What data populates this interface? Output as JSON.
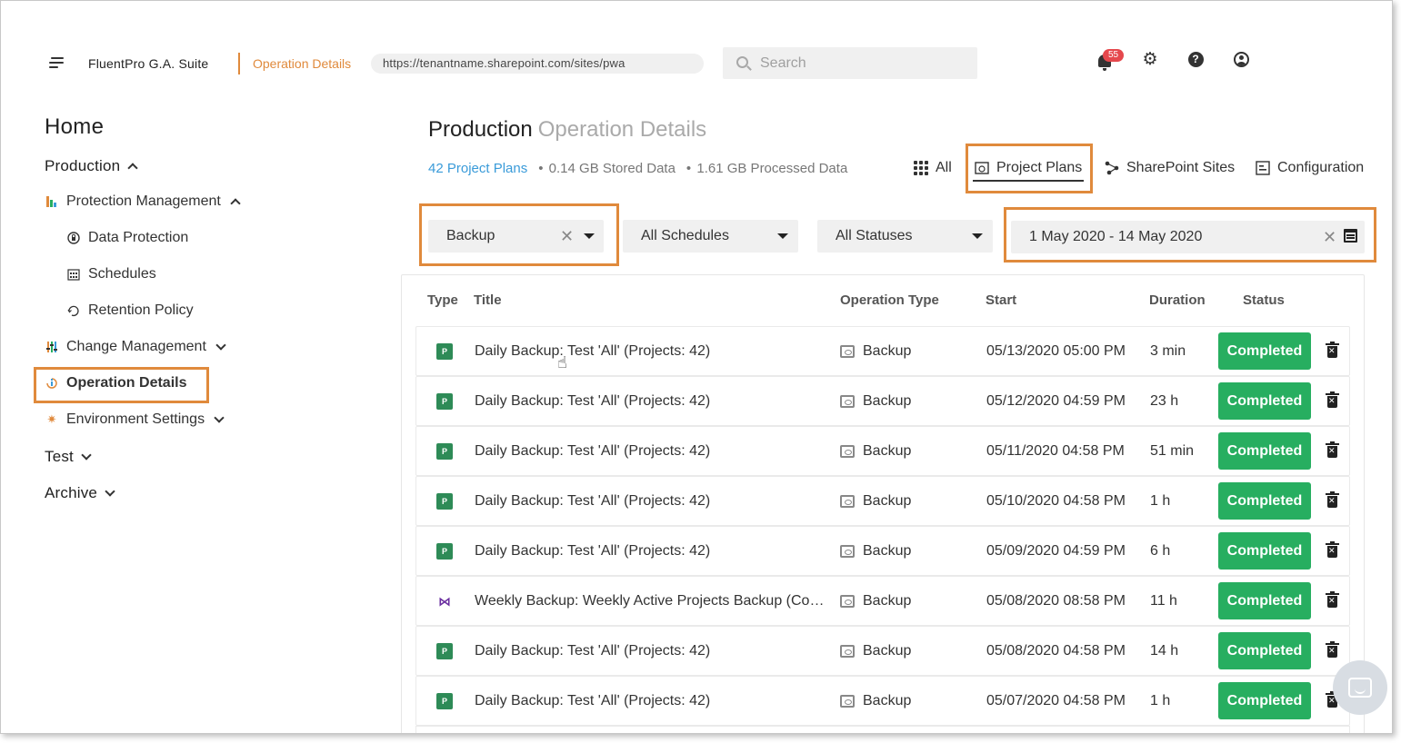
{
  "header": {
    "brand": "FluentPro G.A. Suite",
    "page": "Operation Details",
    "url": "https://tenantname.sharepoint.com/sites/pwa",
    "search_placeholder": "Search",
    "notifications_count": "55",
    "help_glyph": "?",
    "gear_glyph": "⚙"
  },
  "sidebar": {
    "home": "Home",
    "production": "Production",
    "protection_management": "Protection Management",
    "data_protection": "Data Protection",
    "schedules": "Schedules",
    "retention_policy": "Retention Policy",
    "change_management": "Change Management",
    "operation_details": "Operation Details",
    "environment_settings": "Environment Settings",
    "test": "Test",
    "archive": "Archive"
  },
  "main": {
    "title": "Production",
    "subtitle": "Operation Details",
    "stats": {
      "projects_link": "42 Project Plans",
      "stored": "0.14 GB Stored Data",
      "processed": "1.61 GB Processed Data",
      "bullet": "•"
    },
    "filter_tabs": {
      "all": "All",
      "project_plans": "Project Plans",
      "sharepoint_sites": "SharePoint Sites",
      "configuration": "Configuration"
    },
    "filters": {
      "operation": "Backup",
      "schedules": "All Schedules",
      "statuses": "All Statuses",
      "date_range": "1 May 2020 - 14 May 2020",
      "clear_glyph": "✕"
    },
    "columns": {
      "type": "Type",
      "title": "Title",
      "operation_type": "Operation Type",
      "start": "Start",
      "duration": "Duration",
      "status": "Status"
    },
    "rows": [
      {
        "type": "P",
        "title": "Daily Backup: Test 'All' (Projects: 42)",
        "op": "Backup",
        "start": "05/13/2020 05:00 PM",
        "duration": "3 min",
        "status": "Completed"
      },
      {
        "type": "P",
        "title": "Daily Backup: Test 'All' (Projects: 42)",
        "op": "Backup",
        "start": "05/12/2020 04:59 PM",
        "duration": "23 h",
        "status": "Completed"
      },
      {
        "type": "P",
        "title": "Daily Backup: Test 'All' (Projects: 42)",
        "op": "Backup",
        "start": "05/11/2020 04:58 PM",
        "duration": "51 min",
        "status": "Completed"
      },
      {
        "type": "P",
        "title": "Daily Backup: Test 'All' (Projects: 42)",
        "op": "Backup",
        "start": "05/10/2020 04:58 PM",
        "duration": "1 h",
        "status": "Completed"
      },
      {
        "type": "P",
        "title": "Daily Backup: Test 'All' (Projects: 42)",
        "op": "Backup",
        "start": "05/09/2020 04:59 PM",
        "duration": "6 h",
        "status": "Completed"
      },
      {
        "type": "⋈",
        "title": "Weekly Backup: Weekly Active Projects Backup (Con...",
        "op": "Backup",
        "start": "05/08/2020 08:58 PM",
        "duration": "11 h",
        "status": "Completed"
      },
      {
        "type": "P",
        "title": "Daily Backup: Test 'All' (Projects: 42)",
        "op": "Backup",
        "start": "05/08/2020 04:58 PM",
        "duration": "14 h",
        "status": "Completed"
      },
      {
        "type": "P",
        "title": "Daily Backup: Test 'All' (Projects: 42)",
        "op": "Backup",
        "start": "05/07/2020 04:58 PM",
        "duration": "1 h",
        "status": "Completed"
      }
    ]
  },
  "colors": {
    "accent_orange": "#e08a3c",
    "link_blue": "#3a9bd9",
    "status_green": "#27ae60",
    "badge_red": "#e5484d"
  }
}
